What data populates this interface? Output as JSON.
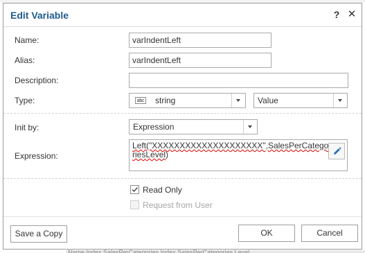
{
  "dialog": {
    "title": "Edit Variable",
    "help_icon": "?",
    "close_icon": "✕"
  },
  "form": {
    "name_label": "Name:",
    "name_value": "varIndentLeft",
    "alias_label": "Alias:",
    "alias_value": "varIndentLeft",
    "description_label": "Description:",
    "description_value": "",
    "type_label": "Type:",
    "type_icon_text": "abc",
    "type_value": "string",
    "kind_value": "Value",
    "init_label": "Init by:",
    "init_value": "Expression",
    "expression_label": "Expression:",
    "expression_prefix": "Left(\"XXXXXXXXXXXXXXXXXXXX\",",
    "expression_err1": "SalesPerCategories",
    "expression_err2": "Level",
    "expression_suffix": ")",
    "read_only_label": "Read Only",
    "read_only_checked": true,
    "request_label": "Request from User",
    "request_checked": false
  },
  "buttons": {
    "save_copy": "Save a Copy",
    "ok": "OK",
    "cancel": "Cancel"
  },
  "background": {
    "bottom_text": "Name.Index  SalesPerCategories.Index  SalesPerCategories.Level"
  }
}
